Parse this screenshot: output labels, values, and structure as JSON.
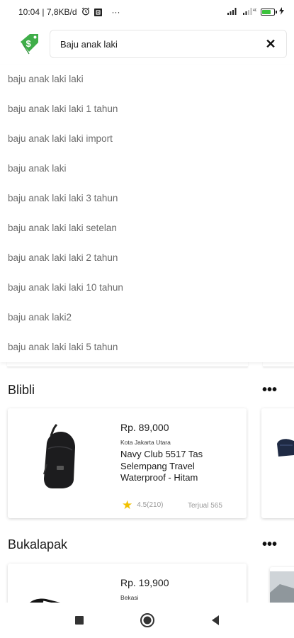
{
  "status_bar": {
    "time_speed": "10:04 | 7,8KB/d",
    "alarm_icon": "alarm-clock-icon",
    "notification_icon": "notification-box-icon",
    "more_dots": "···",
    "signal_icons": [
      "signal-icon",
      "signal-icon"
    ],
    "battery_level": 0.85,
    "colors": {
      "battery": "#3cc23c"
    }
  },
  "header": {
    "logo_icon": "price-tag-dollar-icon",
    "search": {
      "value": "Baju anak laki",
      "clear_label": "✕"
    },
    "colors": {
      "logo_green": "#3fae49"
    }
  },
  "suggestions": [
    "baju anak laki laki",
    "baju anak laki laki 1 tahun",
    "baju anak laki laki import",
    "baju anak laki",
    "baju anak laki laki 3 tahun",
    "baju anak laki laki setelan",
    "baju anak laki laki 2 tahun",
    "baju anak laki laki 10 tahun",
    "baju anak laki2",
    "baju anak laki laki 5 tahun"
  ],
  "sections": [
    {
      "title": "Blibli",
      "more_label": "•••",
      "product": {
        "price": "Rp. 89,000",
        "location": "Kota Jakarta Utara",
        "name": "Navy Club 5517 Tas Selempang Travel Waterproof - Hitam",
        "rating": "4.5(210)",
        "sold": "Terjual 565",
        "image_icon": "sling-bag-image"
      }
    },
    {
      "title": "Bukalapak",
      "more_label": "•••",
      "product": {
        "price": "Rp. 19,900",
        "location": "Bekasi",
        "image_icon": "shoe-image"
      }
    }
  ],
  "nav_bar": {
    "recent_icon": "square-recents-icon",
    "home_icon": "circle-home-icon",
    "back_icon": "triangle-back-icon"
  }
}
